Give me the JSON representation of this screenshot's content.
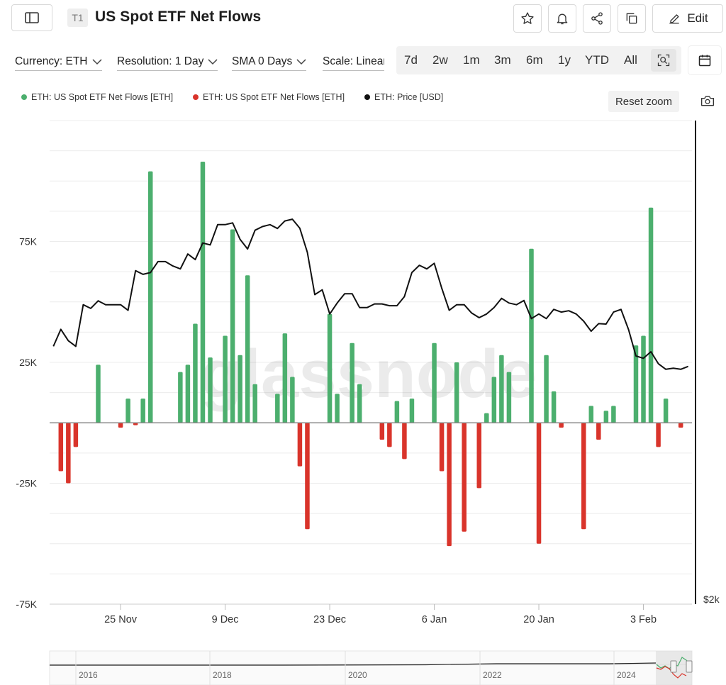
{
  "header": {
    "badge": "T1",
    "title": "US Spot ETF Net Flows",
    "edit_label": "Edit"
  },
  "controls": {
    "currency": "Currency: ETH",
    "resolution": "Resolution: 1 Day",
    "sma": "SMA 0 Days",
    "scale": "Scale: Linear",
    "ranges": [
      "7d",
      "2w",
      "1m",
      "3m",
      "6m",
      "1y",
      "YTD",
      "All"
    ]
  },
  "legend": {
    "items": [
      {
        "label": "ETH: US Spot ETF Net Flows [ETH]",
        "color": "#4caf6e"
      },
      {
        "label": "ETH: US Spot ETF Net Flows [ETH]",
        "color": "#d9342b"
      },
      {
        "label": "ETH: Price [USD]",
        "color": "#111111"
      }
    ],
    "reset_zoom": "Reset zoom"
  },
  "watermark": "glassnode",
  "chart_data": {
    "type": "bar",
    "y_axis": {
      "ticks": [
        "75K",
        "25K",
        "-25K",
        "-75K"
      ],
      "tick_values": [
        75000,
        25000,
        -25000,
        -75000
      ],
      "ylim": [
        -75000,
        125000
      ],
      "grid": true
    },
    "right_axis": {
      "label": "$2k"
    },
    "x_ticks": [
      {
        "label": "25 Nov",
        "day": 3
      },
      {
        "label": "9 Dec",
        "day": 17
      },
      {
        "label": "23 Dec",
        "day": 31
      },
      {
        "label": "6 Jan",
        "day": 45
      },
      {
        "label": "20 Jan",
        "day": 59
      },
      {
        "label": "3 Feb",
        "day": 73
      }
    ],
    "x_range_days": [
      -6.5,
      79.5
    ],
    "flows": [
      {
        "day": -5,
        "value": -20000
      },
      {
        "day": -4,
        "value": -25000
      },
      {
        "day": -3,
        "value": -10000
      },
      {
        "day": -2,
        "value": 0
      },
      {
        "day": -1,
        "value": 0
      },
      {
        "day": 0,
        "value": 24000
      },
      {
        "day": 1,
        "value": 0
      },
      {
        "day": 2,
        "value": 0
      },
      {
        "day": 3,
        "value": -2000
      },
      {
        "day": 4,
        "value": 10000
      },
      {
        "day": 5,
        "value": -1000
      },
      {
        "day": 6,
        "value": 10000
      },
      {
        "day": 7,
        "value": 104000
      },
      {
        "day": 8,
        "value": 0
      },
      {
        "day": 9,
        "value": 0
      },
      {
        "day": 10,
        "value": 0
      },
      {
        "day": 11,
        "value": 21000
      },
      {
        "day": 12,
        "value": 24000
      },
      {
        "day": 13,
        "value": 41000
      },
      {
        "day": 14,
        "value": 108000
      },
      {
        "day": 15,
        "value": 27000
      },
      {
        "day": 16,
        "value": 0
      },
      {
        "day": 17,
        "value": 36000
      },
      {
        "day": 18,
        "value": 80000
      },
      {
        "day": 19,
        "value": 28000
      },
      {
        "day": 20,
        "value": 61000
      },
      {
        "day": 21,
        "value": 16000
      },
      {
        "day": 22,
        "value": 0
      },
      {
        "day": 23,
        "value": 0
      },
      {
        "day": 24,
        "value": 12000
      },
      {
        "day": 25,
        "value": 37000
      },
      {
        "day": 26,
        "value": 19000
      },
      {
        "day": 27,
        "value": -18000
      },
      {
        "day": 28,
        "value": -44000
      },
      {
        "day": 29,
        "value": 0
      },
      {
        "day": 30,
        "value": 0
      },
      {
        "day": 31,
        "value": 45000
      },
      {
        "day": 32,
        "value": 12000
      },
      {
        "day": 33,
        "value": 0
      },
      {
        "day": 34,
        "value": 33000
      },
      {
        "day": 35,
        "value": 16000
      },
      {
        "day": 36,
        "value": 0
      },
      {
        "day": 37,
        "value": 0
      },
      {
        "day": 38,
        "value": -7000
      },
      {
        "day": 39,
        "value": -10000
      },
      {
        "day": 40,
        "value": 9000
      },
      {
        "day": 41,
        "value": -15000
      },
      {
        "day": 42,
        "value": 10000
      },
      {
        "day": 43,
        "value": 0
      },
      {
        "day": 44,
        "value": 0
      },
      {
        "day": 45,
        "value": 33000
      },
      {
        "day": 46,
        "value": -20000
      },
      {
        "day": 47,
        "value": -51000
      },
      {
        "day": 48,
        "value": 25000
      },
      {
        "day": 49,
        "value": -45000
      },
      {
        "day": 50,
        "value": 0
      },
      {
        "day": 51,
        "value": -27000
      },
      {
        "day": 52,
        "value": 4000
      },
      {
        "day": 53,
        "value": 19000
      },
      {
        "day": 54,
        "value": 28000
      },
      {
        "day": 55,
        "value": 21000
      },
      {
        "day": 56,
        "value": 0
      },
      {
        "day": 57,
        "value": 0
      },
      {
        "day": 58,
        "value": 72000
      },
      {
        "day": 59,
        "value": -50000
      },
      {
        "day": 60,
        "value": 28000
      },
      {
        "day": 61,
        "value": 13000
      },
      {
        "day": 62,
        "value": -2000
      },
      {
        "day": 63,
        "value": 0
      },
      {
        "day": 64,
        "value": 0
      },
      {
        "day": 65,
        "value": -44000
      },
      {
        "day": 66,
        "value": 7000
      },
      {
        "day": 67,
        "value": -7000
      },
      {
        "day": 68,
        "value": 5000
      },
      {
        "day": 69,
        "value": 7000
      },
      {
        "day": 70,
        "value": 0
      },
      {
        "day": 71,
        "value": 0
      },
      {
        "day": 72,
        "value": 32000
      },
      {
        "day": 73,
        "value": 36000
      },
      {
        "day": 74,
        "value": 89000
      },
      {
        "day": 75,
        "value": -10000
      },
      {
        "day": 76,
        "value": 10000
      },
      {
        "day": 77,
        "value": 0
      },
      {
        "day": 78,
        "value": -2000
      }
    ],
    "price_series": {
      "name": "ETH: Price [USD]",
      "values": [
        [
          -6,
          3333
        ],
        [
          -5,
          3421
        ],
        [
          -4,
          3362
        ],
        [
          -3,
          3333
        ],
        [
          -2,
          3548
        ],
        [
          -1,
          3529
        ],
        [
          0,
          3568
        ],
        [
          1,
          3548
        ],
        [
          2,
          3548
        ],
        [
          3,
          3548
        ],
        [
          4,
          3519
        ],
        [
          5,
          3724
        ],
        [
          6,
          3705
        ],
        [
          7,
          3714
        ],
        [
          8,
          3771
        ],
        [
          9,
          3771
        ],
        [
          10,
          3748
        ],
        [
          11,
          3733
        ],
        [
          12,
          3810
        ],
        [
          13,
          3781
        ],
        [
          14,
          3867
        ],
        [
          15,
          3857
        ],
        [
          16,
          3962
        ],
        [
          17,
          3962
        ],
        [
          18,
          3971
        ],
        [
          19,
          3886
        ],
        [
          20,
          3836
        ],
        [
          21,
          3933
        ],
        [
          22,
          3952
        ],
        [
          23,
          3962
        ],
        [
          24,
          3942
        ],
        [
          25,
          3981
        ],
        [
          26,
          3990
        ],
        [
          27,
          3943
        ],
        [
          28,
          3819
        ],
        [
          29,
          3600
        ],
        [
          30,
          3625
        ],
        [
          31,
          3500
        ],
        [
          32,
          3557
        ],
        [
          33,
          3605
        ],
        [
          34,
          3605
        ],
        [
          35,
          3533
        ],
        [
          36,
          3533
        ],
        [
          37,
          3552
        ],
        [
          38,
          3552
        ],
        [
          39,
          3543
        ],
        [
          40,
          3543
        ],
        [
          41,
          3590
        ],
        [
          42,
          3714
        ],
        [
          43,
          3752
        ],
        [
          44,
          3733
        ],
        [
          45,
          3762
        ],
        [
          46,
          3633
        ],
        [
          47,
          3519
        ],
        [
          48,
          3548
        ],
        [
          49,
          3548
        ],
        [
          50,
          3505
        ],
        [
          51,
          3481
        ],
        [
          52,
          3500
        ],
        [
          53,
          3533
        ],
        [
          54,
          3581
        ],
        [
          55,
          3557
        ],
        [
          56,
          3548
        ],
        [
          57,
          3570
        ],
        [
          58,
          3476
        ],
        [
          59,
          3500
        ],
        [
          60,
          3476
        ],
        [
          61,
          3524
        ],
        [
          62,
          3510
        ],
        [
          63,
          3517
        ],
        [
          64,
          3500
        ],
        [
          65,
          3463
        ],
        [
          66,
          3411
        ],
        [
          67,
          3450
        ],
        [
          68,
          3448
        ],
        [
          69,
          3510
        ],
        [
          70,
          3524
        ],
        [
          71,
          3420
        ],
        [
          72,
          3283
        ],
        [
          73,
          3271
        ],
        [
          74,
          3305
        ],
        [
          75,
          3243
        ],
        [
          76,
          3214
        ],
        [
          77,
          3220
        ],
        [
          78,
          3214
        ],
        [
          79,
          3229
        ]
      ],
      "price_range": [
        2000,
        4500
      ]
    }
  },
  "navigator": {
    "years": [
      "2016",
      "2018",
      "2020",
      "2022",
      "2024"
    ]
  }
}
